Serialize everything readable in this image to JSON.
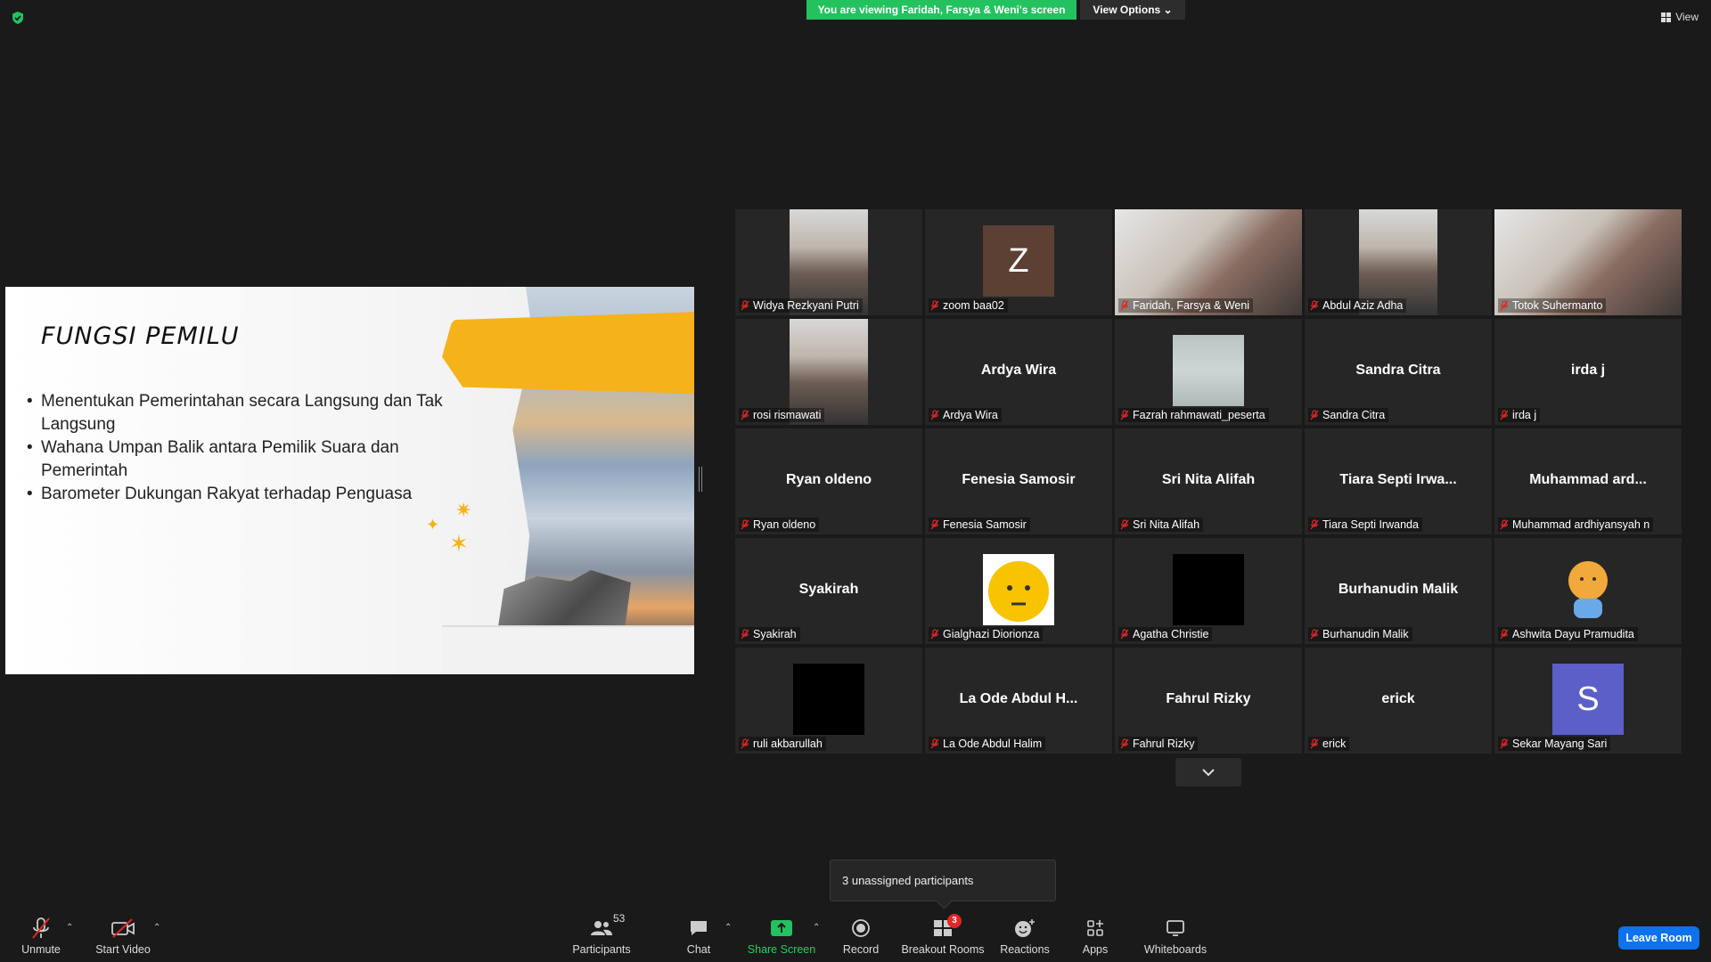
{
  "top_bar": {
    "viewing_banner": "You are viewing Faridah, Farsya & Weni's screen",
    "view_options": "View Options ⌄",
    "view_button": "View"
  },
  "slide": {
    "title": "FUNGSI PEMILU",
    "bullets": [
      "Menentukan Pemerintahan secara Langsung dan Tak Langsung",
      "Wahana Umpan Balik antara Pemilik Suara dan Pemerintah",
      "Barometer Dukungan Rakyat terhadap Penguasa"
    ],
    "accent_color": "#f5b21a"
  },
  "gallery": {
    "tiles": [
      {
        "label": "Widya Rezkyani Putri",
        "center": "",
        "avatar": "photo"
      },
      {
        "label": "zoom baa02",
        "center": "",
        "avatar": "initial",
        "initial": "Z",
        "color": "#5c4033"
      },
      {
        "label": "Faridah, Farsya & Weni",
        "center": "",
        "avatar": "photo-wide",
        "active": true
      },
      {
        "label": "Abdul Aziz Adha",
        "center": "",
        "avatar": "photo"
      },
      {
        "label": "Totok Suhermanto",
        "center": "",
        "avatar": "photo-wide"
      },
      {
        "label": "rosi rismawati",
        "center": "",
        "avatar": "photo"
      },
      {
        "label": "Ardya Wira",
        "center": "Ardya Wira"
      },
      {
        "label": "Fazrah rahmawati_peserta",
        "center": "",
        "avatar": "blur"
      },
      {
        "label": "Sandra Citra",
        "center": "Sandra Citra"
      },
      {
        "label": "irda j",
        "center": "irda j"
      },
      {
        "label": "Ryan oldeno",
        "center": "Ryan oldeno"
      },
      {
        "label": "Fenesia Samosir",
        "center": "Fenesia Samosir"
      },
      {
        "label": "Sri Nita Alifah",
        "center": "Sri Nita Alifah"
      },
      {
        "label": "Tiara Septi Irwanda",
        "center": "Tiara Septi  Irwa..."
      },
      {
        "label": "Muhammad ardhiyansyah n",
        "center": "Muhammad  ard..."
      },
      {
        "label": "Syakirah",
        "center": "Syakirah"
      },
      {
        "label": "Gialghazi Diorionza",
        "center": "",
        "avatar": "emoji"
      },
      {
        "label": "Agatha Christie",
        "center": "",
        "avatar": "black"
      },
      {
        "label": "Burhanudin Malik",
        "center": "Burhanudin Malik"
      },
      {
        "label": "Ashwita Dayu Pramudita",
        "center": "",
        "avatar": "character"
      },
      {
        "label": "ruli akbarullah",
        "center": "",
        "avatar": "black"
      },
      {
        "label": "La Ode Abdul Halim",
        "center": "La Ode Abdul H..."
      },
      {
        "label": "Fahrul Rizky",
        "center": "Fahrul Rizky"
      },
      {
        "label": "erick",
        "center": "erick"
      },
      {
        "label": "Sekar Mayang Sari",
        "center": "",
        "avatar": "initial",
        "initial": "S",
        "color": "#5b5fc7"
      }
    ]
  },
  "popup": {
    "unassigned": "3 unassigned participants"
  },
  "toolbar": {
    "unmute": "Unmute",
    "start_video": "Start Video",
    "participants": "Participants",
    "participants_count": "53",
    "chat": "Chat",
    "share_screen": "Share Screen",
    "record": "Record",
    "breakout_rooms": "Breakout Rooms",
    "breakout_badge": "3",
    "reactions": "Reactions",
    "apps": "Apps",
    "whiteboards": "Whiteboards",
    "leave": "Leave Room"
  },
  "colors": {
    "share_green": "#23c25f",
    "active_speaker": "#d6e640",
    "leave_blue": "#0e72ed",
    "mic_off_red": "#e02828"
  }
}
